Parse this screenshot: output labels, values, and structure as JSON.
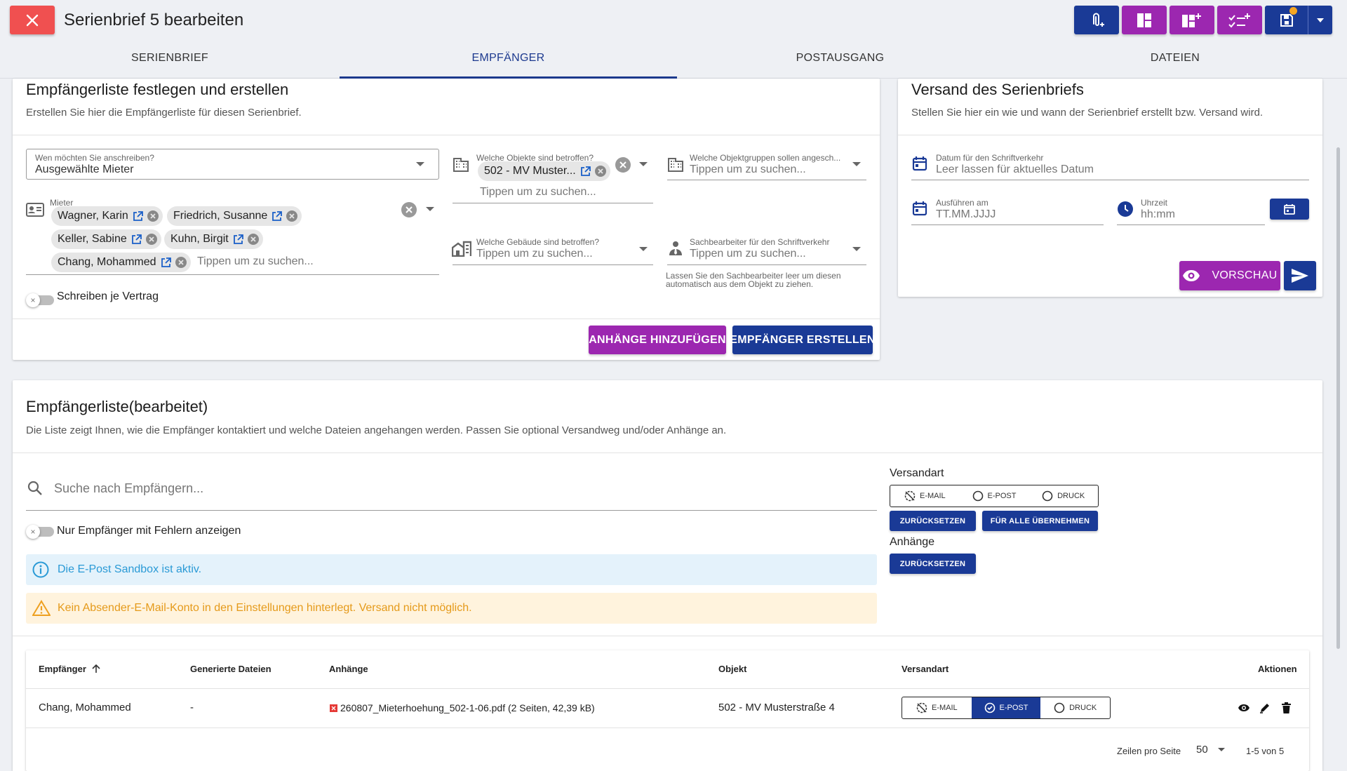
{
  "header": {
    "title": "Serienbrief 5 bearbeiten"
  },
  "tabs": [
    {
      "label": "SERIENBRIEF"
    },
    {
      "label": "EMPFÄNGER"
    },
    {
      "label": "POSTAUSGANG"
    },
    {
      "label": "DATEIEN"
    }
  ],
  "recipients_card": {
    "title": "Empfängerliste festlegen und erstellen",
    "subtitle": "Erstellen Sie hier die Empfängerliste für diesen Serienbrief.",
    "whom": {
      "label": "Wen möchten Sie anschreiben?",
      "value": "Ausgewählte Mieter"
    },
    "tenants": {
      "label": "Mieter",
      "chips": [
        "Wagner, Karin",
        "Friedrich, Susanne",
        "Keller, Sabine",
        "Kuhn, Birgit",
        "Chang, Mohammed"
      ],
      "placeholder": "Tippen um zu suchen..."
    },
    "objects": {
      "label": "Welche Objekte sind betroffen?",
      "chip": "502 - MV Muster...",
      "placeholder": "Tippen um zu suchen..."
    },
    "groups": {
      "label": "Welche Objektgruppen sollen angesch...",
      "placeholder": "Tippen um zu suchen..."
    },
    "buildings": {
      "label": "Welche Gebäude sind betroffen?",
      "placeholder": "Tippen um zu suchen..."
    },
    "clerk": {
      "label": "Sachbearbeiter für den Schriftverkehr",
      "placeholder": "Tippen um zu suchen...",
      "hint_line1": "Lassen Sie den Sachbearbeiter leer um diesen",
      "hint_line2": "automatisch aus dem Objekt zu ziehen."
    },
    "per_contract": "Schreiben je Vertrag",
    "btn_attachments": "ANHÄNGE HINZUFÜGEN",
    "btn_create": "EMPFÄNGER ERSTELLEN"
  },
  "shipping_card": {
    "title": "Versand des Serienbriefs",
    "subtitle": "Stellen Sie hier ein wie und wann der Serienbrief erstellt bzw. Versand wird.",
    "date": {
      "label": "Datum für den Schriftverkehr",
      "placeholder": "Leer lassen für aktuelles Datum"
    },
    "exec": {
      "label": "Ausführen am",
      "placeholder": "TT.MM.JJJJ"
    },
    "time": {
      "label": "Uhrzeit",
      "placeholder": "hh:mm"
    },
    "btn_preview": "VORSCHAU"
  },
  "list_card": {
    "title": "Empfängerliste(bearbeitet)",
    "subtitle": "Die Liste zeigt Ihnen, wie die Empfänger kontaktiert und welche Dateien angehangen werden. Passen Sie optional Versandweg und/oder Anhänge an.",
    "search_placeholder": "Suche nach Empfängern...",
    "errors_only": "Nur Empfänger mit Fehlern anzeigen",
    "info": "Die E-Post Sandbox ist aktiv.",
    "warning": "Kein Absender-E-Mail-Konto in den Einstellungen hinterlegt. Versand nicht möglich.",
    "versandart": {
      "title": "Versandart",
      "options": [
        "E-MAIL",
        "E-POST",
        "DRUCK"
      ],
      "btn_reset": "ZURÜCKSETZEN",
      "btn_apply": "FÜR ALLE ÜBERNEHMEN"
    },
    "anhaenge": {
      "title": "Anhänge",
      "btn_reset": "ZURÜCKSETZEN"
    },
    "table": {
      "headers": [
        "Empfänger",
        "Generierte Dateien",
        "Anhänge",
        "Objekt",
        "Versandart",
        "Aktionen"
      ],
      "rows": [
        {
          "recipient": "Chang, Mohammed",
          "generated": "-",
          "attachment": "260807_Mieterhoehung_502-1-06.pdf (2 Seiten, 42,39 kB)",
          "object": "502 - MV Musterstraße 4",
          "options": [
            "E-MAIL",
            "E-POST",
            "DRUCK"
          ],
          "selected": "E-POST"
        }
      ]
    },
    "pagination": {
      "rows_label": "Zeilen pro Seite",
      "rows_value": "50",
      "range": "1-5 von 5"
    }
  },
  "colors": {
    "primary": "#1a3a96",
    "accent": "#9c27b0",
    "danger": "#f05050",
    "info_bg": "#e4f2fb",
    "warn_bg": "#fff3dd"
  }
}
